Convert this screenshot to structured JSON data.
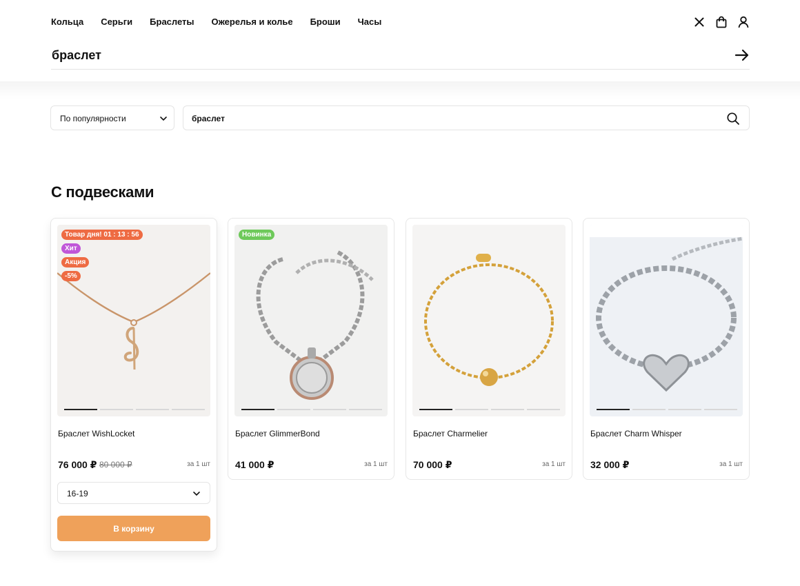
{
  "nav": [
    "Кольца",
    "Серьги",
    "Браслеты",
    "Ожерелья и колье",
    "Броши",
    "Часы"
  ],
  "header_icons": [
    "close-icon",
    "bag-icon",
    "user-icon"
  ],
  "search_bar": {
    "query": "браслет"
  },
  "filters": {
    "sort_label": "По популярности",
    "search_value": "браслет"
  },
  "section_title": "С подвесками",
  "colors": {
    "badge_orange": "#ee6b43",
    "badge_purple": "#c056d8",
    "badge_green": "#6ec95a",
    "cart_button": "#efa15a"
  },
  "products": [
    {
      "name": "Браслет WishLocket",
      "price": "76 000 ₽",
      "old_price": "80 000 ₽",
      "unit": "за 1 шт",
      "badges": [
        "Товар дня!  01 : 13 : 56",
        "Хит",
        "Акция",
        "-5%"
      ],
      "image": "gold necklace with treble clef pendant",
      "size": "16-19",
      "cart_label": "В корзину"
    },
    {
      "name": "Браслет GlimmerBond",
      "price": "41 000 ₽",
      "unit": "за 1 шт",
      "badges": [
        "Новинка"
      ],
      "image": "silver chain bracelet with round coin pendant"
    },
    {
      "name": "Браслет Charmelier",
      "price": "70 000 ₽",
      "unit": "за 1 шт",
      "badges": [],
      "image": "gold chain bracelet with gold bead"
    },
    {
      "name": "Браслет Charm Whisper",
      "price": "32 000 ₽",
      "unit": "за 1 шт",
      "badges": [],
      "image": "silver ball chain bracelet with heart charm"
    }
  ]
}
